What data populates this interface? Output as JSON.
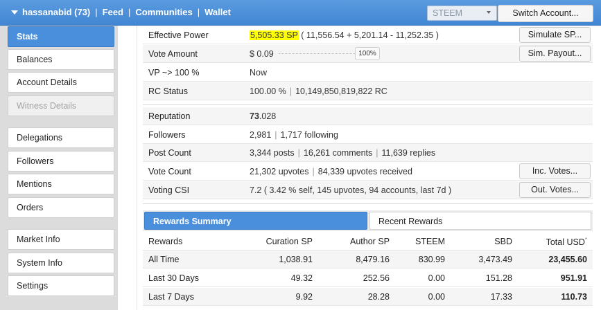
{
  "topbar": {
    "user": "hassanabid (73)",
    "nav": [
      "Feed",
      "Communities",
      "Wallet"
    ],
    "separator": "|",
    "coin": "STEEM",
    "switch_label": "Switch Account..."
  },
  "sidebar": {
    "items": [
      {
        "label": "Stats"
      },
      {
        "label": "Balances"
      },
      {
        "label": "Account Details"
      },
      {
        "label": "Witness Details"
      },
      {
        "label": "Delegations"
      },
      {
        "label": "Followers"
      },
      {
        "label": "Mentions"
      },
      {
        "label": "Orders"
      },
      {
        "label": "Market Info"
      },
      {
        "label": "System Info"
      },
      {
        "label": "Settings"
      }
    ]
  },
  "stats": {
    "effective_power": {
      "label": "Effective Power",
      "value": "5,505.33 SP",
      "detail": "( 11,556.54 + 5,201.14 - 11,252.35 )",
      "button": "Simulate SP..."
    },
    "vote_amount": {
      "label": "Vote Amount",
      "value": "$ 0.09",
      "percent": "100%",
      "button": "Sim. Payout..."
    },
    "vp": {
      "label": "VP ~> 100 %",
      "value": "Now"
    },
    "rc_status": {
      "label": "RC Status",
      "percent": "100.00 %",
      "rc": "10,149,850,819,822 RC"
    },
    "reputation": {
      "label": "Reputation",
      "whole": "73",
      "decimal": ".028"
    },
    "followers": {
      "label": "Followers",
      "count": "2,981",
      "following": "1,717 following"
    },
    "post_count": {
      "label": "Post Count",
      "posts": "3,344 posts",
      "comments": "16,261 comments",
      "replies": "11,639 replies"
    },
    "vote_count": {
      "label": "Vote Count",
      "upvotes": "21,302 upvotes",
      "received": "84,339 upvotes received",
      "button": "Inc. Votes..."
    },
    "voting_csi": {
      "label": "Voting CSI",
      "value": "7.2 ( 3.42 % self, 145 upvotes, 94 accounts, last 7d )",
      "button": "Out. Votes..."
    }
  },
  "rewards": {
    "tabs": [
      "Rewards Summary",
      "Recent Rewards"
    ],
    "columns": [
      "Rewards",
      "Curation SP",
      "Author SP",
      "STEEM",
      "SBD",
      "Total USD"
    ],
    "total_marker": "*",
    "rows": [
      [
        "All Time",
        "1,038.91",
        "8,479.16",
        "830.99",
        "3,473.49",
        "23,455.60"
      ],
      [
        "Last 30 Days",
        "49.32",
        "252.56",
        "0.00",
        "151.28",
        "951.91"
      ],
      [
        "Last 7 Days",
        "9.92",
        "28.28",
        "0.00",
        "17.33",
        "110.73"
      ]
    ]
  },
  "colors": {
    "accent": "#4a8fdc",
    "topbar": "#4a8fd8",
    "highlight": "#ffff00",
    "sidebar_bg": "#dcdcdc"
  }
}
